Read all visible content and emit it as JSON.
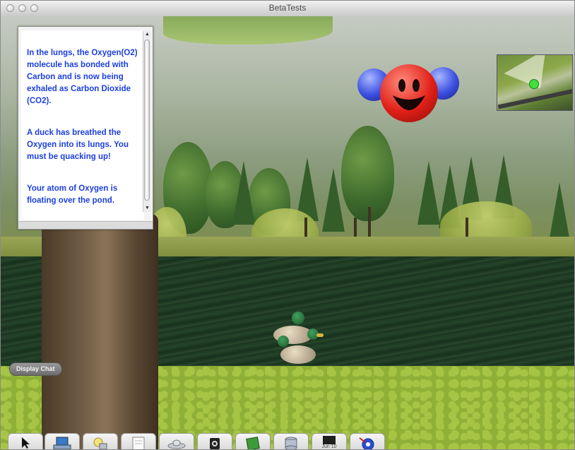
{
  "window": {
    "title": "BetaTests"
  },
  "info_panel": {
    "paragraphs": [
      "In the lungs, the Oxygen(O2)  molecule has bonded with Carbon and is now being exhaled as Carbon Dioxide (CO2).",
      "A duck has breathed the Oxygen into its lungs. You must be quacking up!",
      "Your atom of Oxygen is floating over the pond."
    ],
    "text_color": "#1b3fe0"
  },
  "chat": {
    "label": "Display Chat"
  },
  "toolbar": {
    "tools": [
      {
        "name": "select-tool",
        "icon": "arrow-cursor-icon"
      },
      {
        "name": "computer-tool",
        "icon": "laptop-icon"
      },
      {
        "name": "lamp-tool",
        "icon": "lamp-icon"
      },
      {
        "name": "notes-tool",
        "icon": "paper-icon"
      },
      {
        "name": "saucer-tool",
        "icon": "saucer-icon"
      },
      {
        "name": "camera-tool",
        "icon": "camera-icon"
      },
      {
        "name": "book-tool",
        "icon": "book-icon"
      },
      {
        "name": "database-tool",
        "icon": "disk-stack-icon"
      },
      {
        "name": "calendar-tool",
        "icon": "calendar-icon",
        "label": "Jun 10"
      },
      {
        "name": "molecule-tool",
        "icon": "molecule-icon"
      }
    ]
  },
  "minimap": {
    "player_color": "#3ee03a"
  },
  "molecule": {
    "center_color": "#e02018",
    "side_color": "#3b4fe0"
  }
}
